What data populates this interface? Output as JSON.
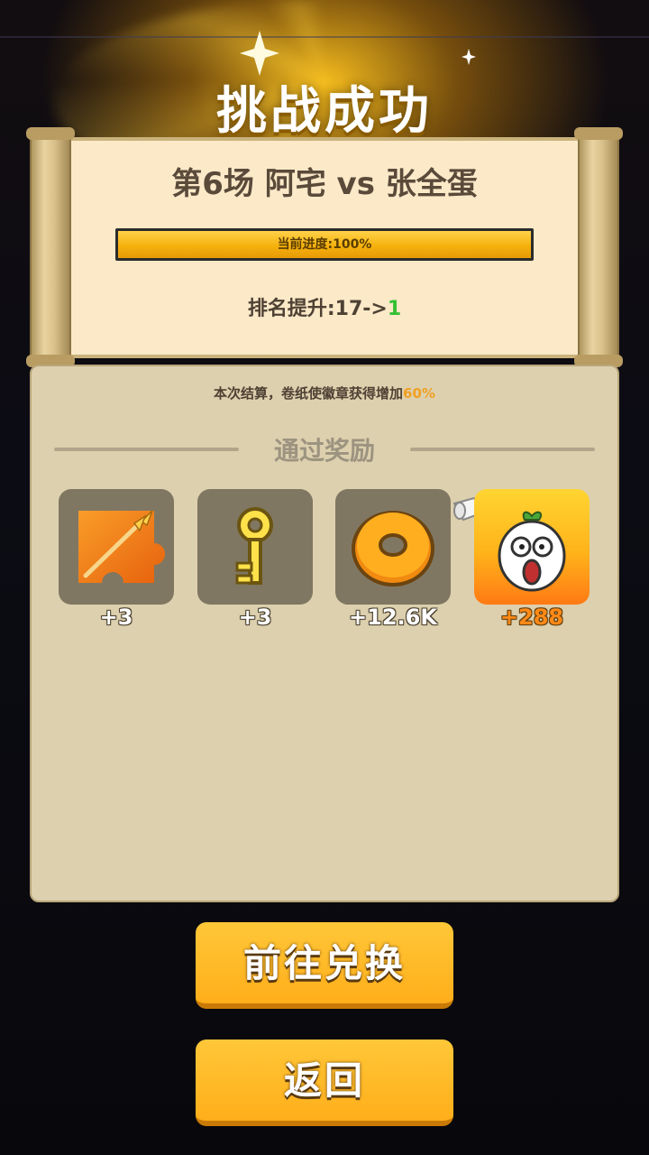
{
  "header": {
    "title": "挑战成功"
  },
  "scroll": {
    "match_title": "第6场 阿宅 vs 张全蛋",
    "progress_label": "当前进度:100%",
    "progress_fraction": 1.0,
    "rank_prefix": "排名提升:17->",
    "rank_new": "1"
  },
  "panel": {
    "bonus_prefix": "本次结算，卷纸使徽章获得增加",
    "bonus_percent": "60%",
    "reward_heading": "通过奖励",
    "rewards": [
      {
        "icon": "spear-puzzle-icon",
        "count": "+3"
      },
      {
        "icon": "key-icon",
        "count": "+3"
      },
      {
        "icon": "donut-coin-icon",
        "count": "+12.6K"
      },
      {
        "icon": "shocked-egg-character-icon",
        "count": "+288"
      }
    ]
  },
  "buttons": {
    "primary_label": "前往兑换",
    "secondary_label": "返回"
  },
  "colors": {
    "accent_orange": "#f0a023",
    "rank_green": "#35c035",
    "button_yellow": "#ffb31a",
    "panel_bg": "#ddd0ae"
  }
}
